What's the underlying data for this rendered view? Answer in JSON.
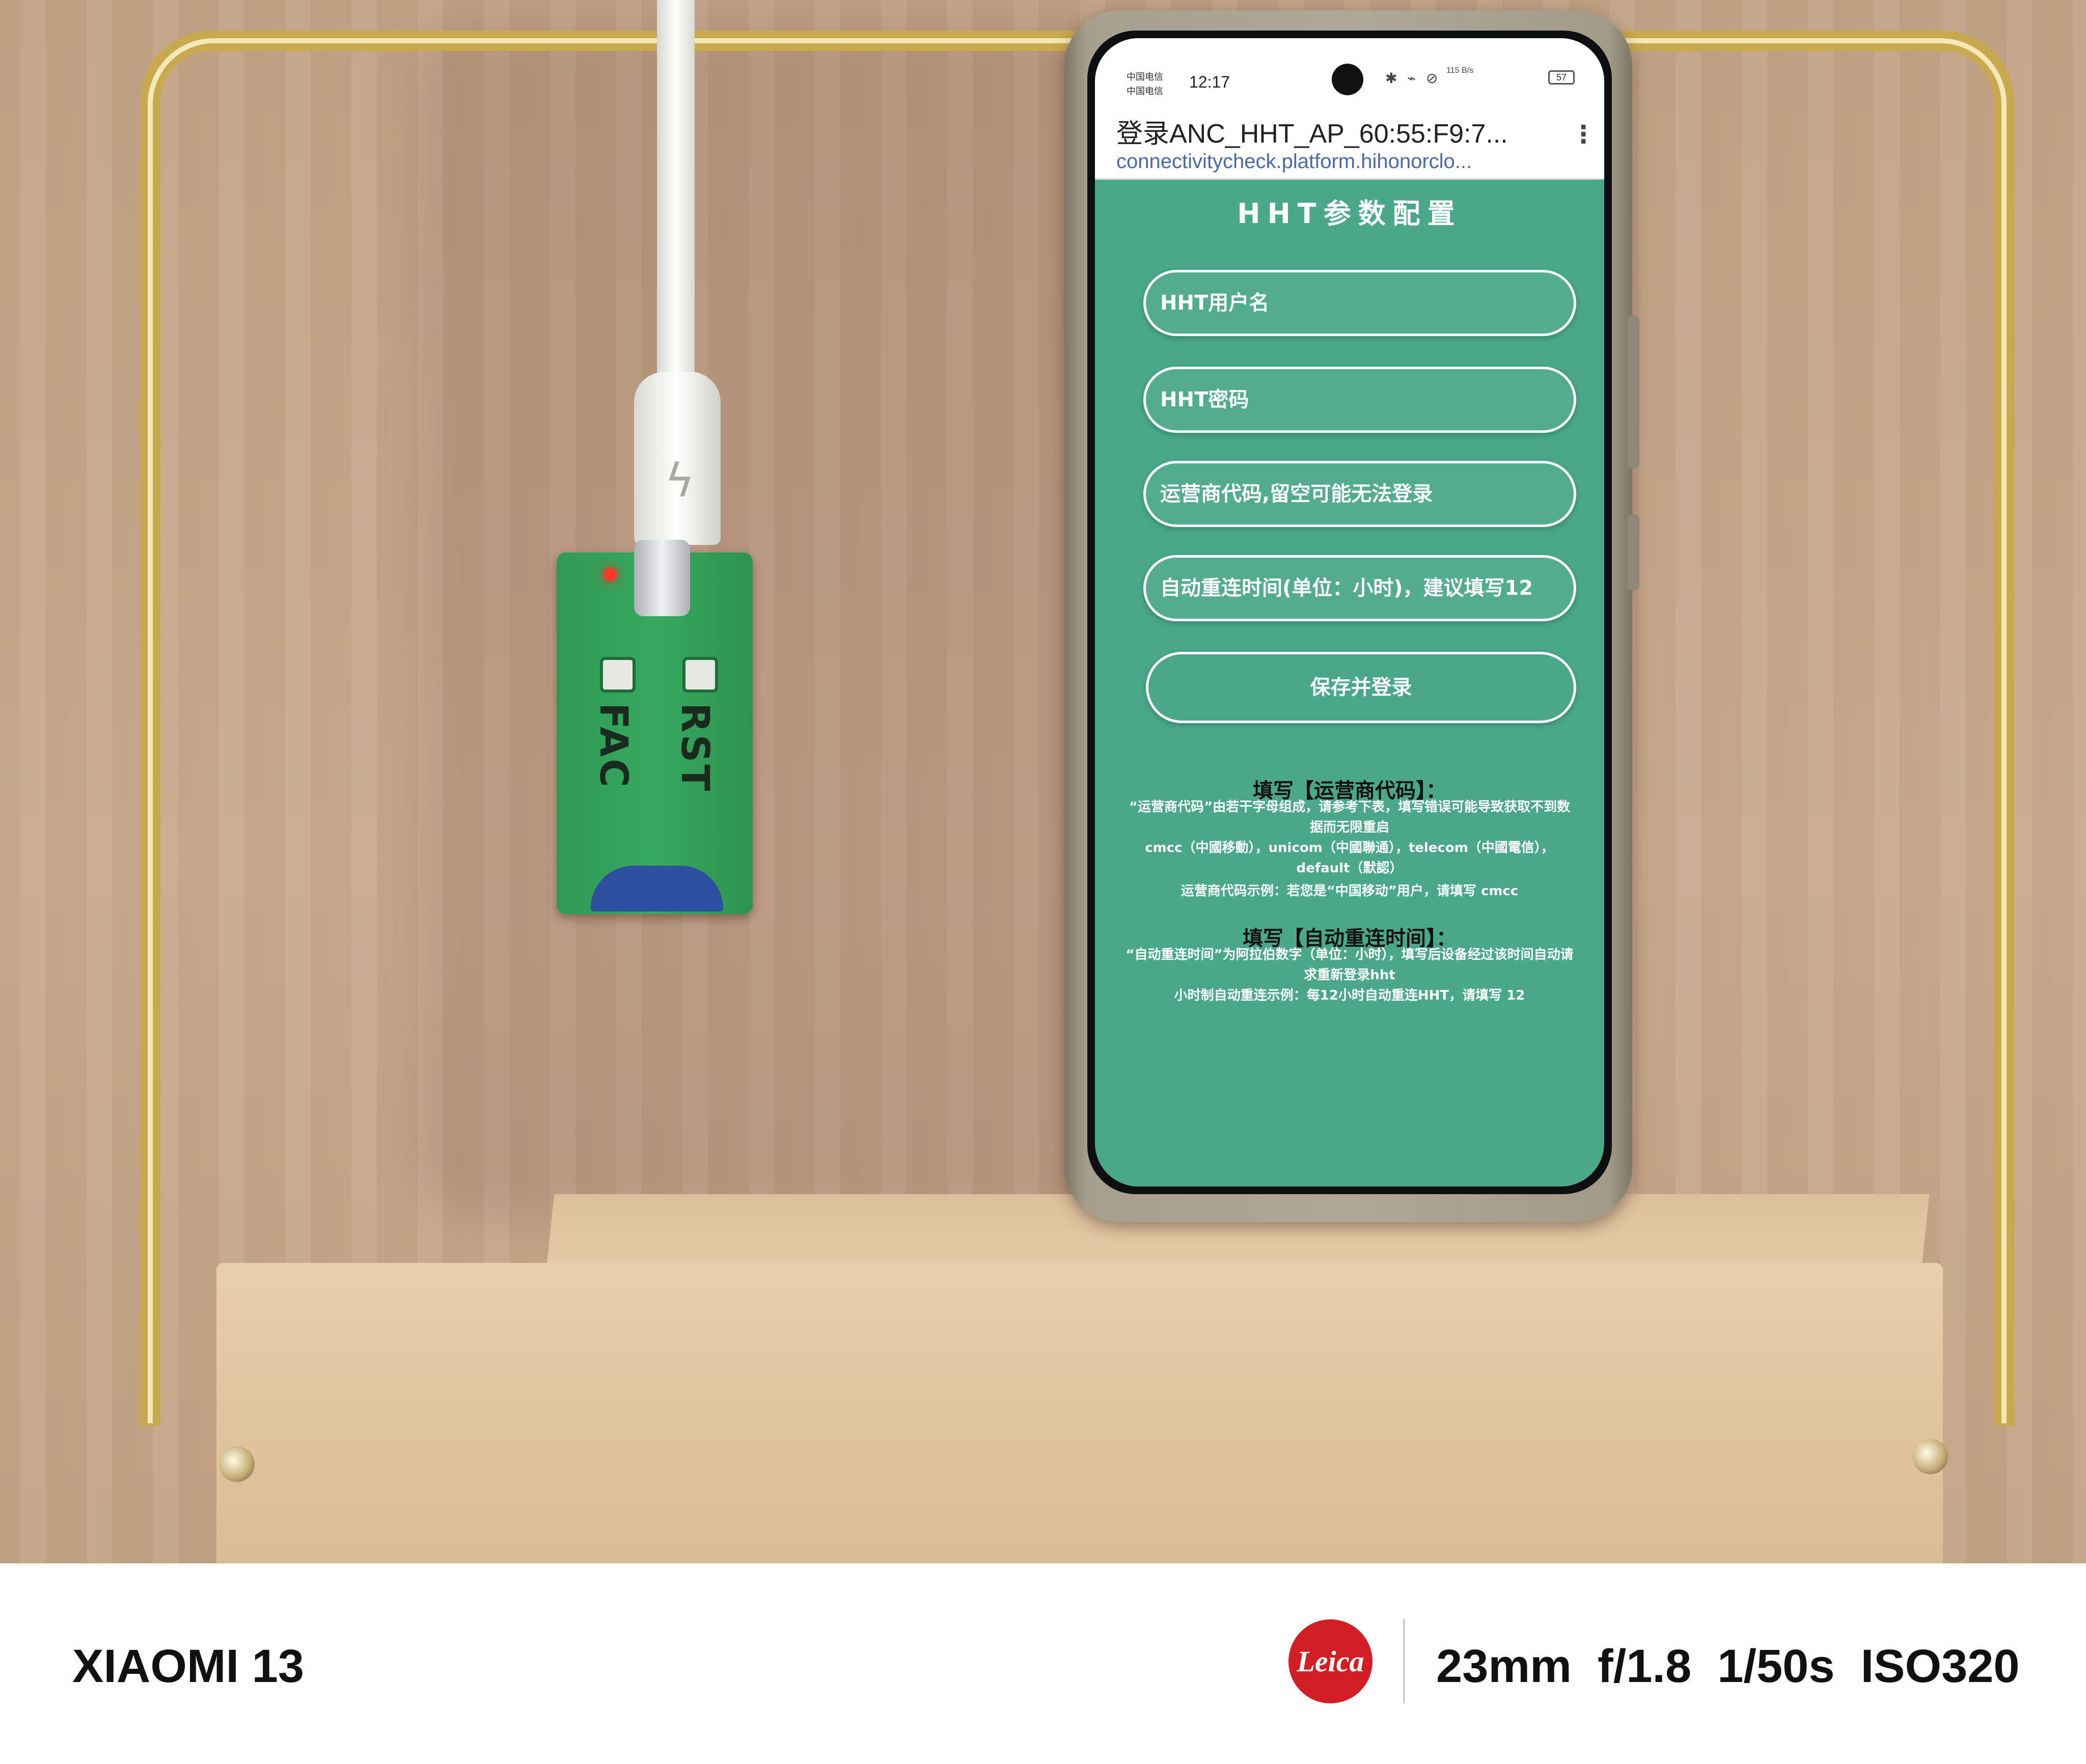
{
  "phone": {
    "status_bar": {
      "carrier_1": "中国电信",
      "carrier_2": "中国电信",
      "time": "12:17",
      "icons": "✱ ⌁ ⊘",
      "net_speed": "115 B/s",
      "battery": "57"
    },
    "browser": {
      "page_title": "登录ANC_HHT_AP_60:55:F9:7...",
      "url": "connectivitycheck.platform.hihonorclo...",
      "menu_icon": "more-vert-icon"
    },
    "form": {
      "heading": "HHT参数配置",
      "username_placeholder": "HHT用户名",
      "password_placeholder": "HHT密码",
      "operator_placeholder": "运营商代码,留空可能无法登录",
      "reconnect_placeholder": "自动重连时间(单位：小时)，建议填写12",
      "save_label": "保存并登录"
    },
    "help": {
      "operator_title": "填写【运营商代码】：",
      "operator_line1": "“运营商代码”由若干字母组成，请参考下表，填写错误可能导致获取不到数据而无限重启",
      "operator_line2": "cmcc（中國移動），unicom（中國聯通），telecom（中國電信），default（默認）",
      "operator_line3": "运营商代码示例：若您是“中国移动”用户，请填写 cmcc",
      "reconnect_title": "填写【自动重连时间】：",
      "reconnect_line1": "“自动重连时间”为阿拉伯数字（单位：小时），填写后设备经过该时间自动请求重新登录hht",
      "reconnect_line2": "小时制自动重连示例：每12小时自动重连HHT，请填写 12"
    }
  },
  "board": {
    "button_1_label": "FAC",
    "button_2_label": "RST"
  },
  "footer": {
    "device": "XIAOMI 13",
    "brand": "Leica",
    "exif": "23mm  f/1.8  1/50s  ISO320"
  },
  "colors": {
    "screen_bg": "#4aa789",
    "board": "#37a85f",
    "frame": "#c9a94f",
    "leica_red": "#d21f26"
  }
}
